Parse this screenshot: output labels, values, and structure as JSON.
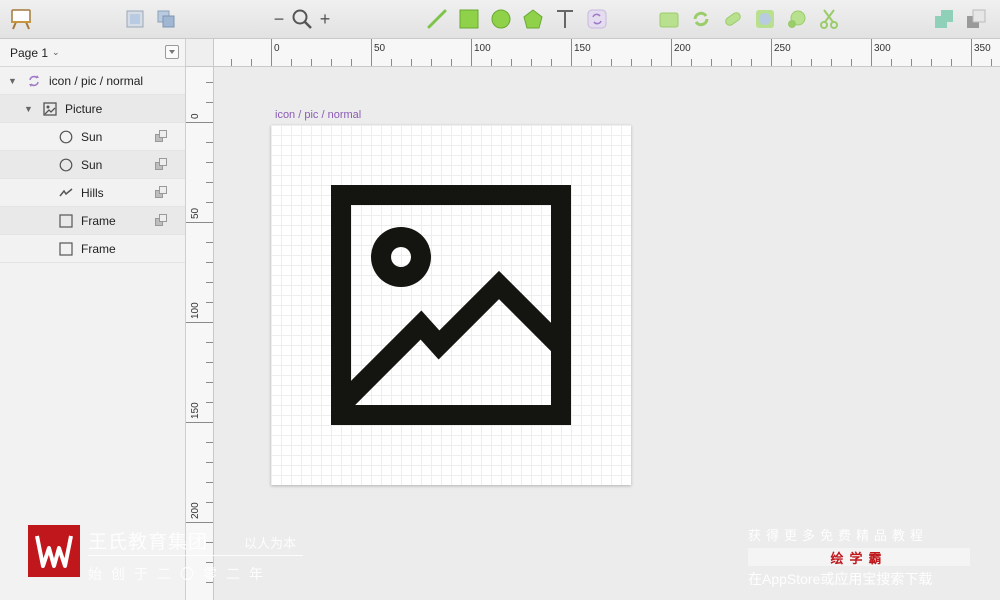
{
  "toolbar": {
    "zoom_out_label": "−",
    "zoom_in_label": "+"
  },
  "sidebar": {
    "page_label": "Page 1",
    "layers": [
      {
        "name": "icon / pic / normal",
        "type": "symbol",
        "expanded": true
      },
      {
        "name": "Picture",
        "type": "image-group",
        "expanded": true
      },
      {
        "name": "Sun",
        "type": "oval",
        "masked": true
      },
      {
        "name": "Sun",
        "type": "oval",
        "masked": true
      },
      {
        "name": "Hills",
        "type": "path",
        "masked": true
      },
      {
        "name": "Frame",
        "type": "rectangle",
        "masked": true
      },
      {
        "name": "Frame",
        "type": "rectangle",
        "masked": false
      }
    ]
  },
  "ruler": {
    "top_labels": [
      "0",
      "50",
      "100",
      "150",
      "200",
      "250",
      "300",
      "350"
    ],
    "left_labels": [
      "0",
      "50",
      "100",
      "150",
      "200"
    ]
  },
  "artboard": {
    "label": "icon / pic / normal",
    "label_color": "#8a5bb5",
    "icon_color": "#141410"
  },
  "watermark": {
    "org_name": "王氏教育集团",
    "motto": "以人为本",
    "since": "始创于二〇零二年",
    "more_tutorials": "获得更多免费精品教程",
    "brand": "绘学霸",
    "get_app": "在AppStore或应用宝搜索下载",
    "brand_color": "#c0171d"
  }
}
